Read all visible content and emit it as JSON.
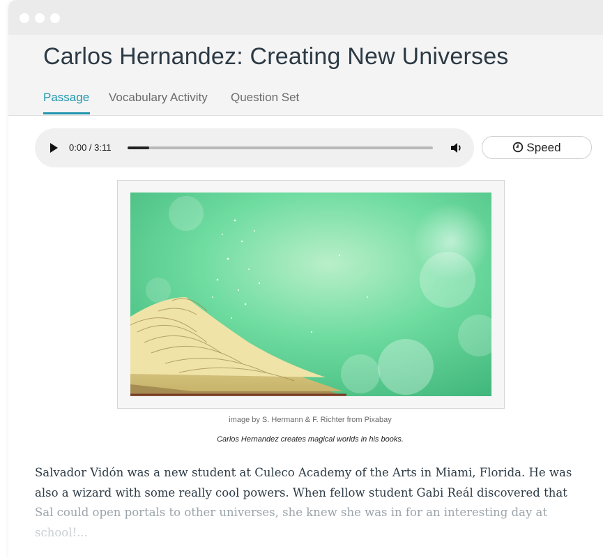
{
  "page": {
    "title": "Carlos Hernandez: Creating New Universes"
  },
  "tabs": [
    {
      "label": "Passage",
      "active": true
    },
    {
      "label": "Vocabulary Activity",
      "active": false
    },
    {
      "label": "Question Set",
      "active": false
    }
  ],
  "audio": {
    "time": "0:00 / 3:11",
    "progress": 0.07,
    "play_icon": "play-icon",
    "volume_icon": "volume-icon"
  },
  "speed_button": {
    "label": "Speed",
    "icon": "clock-icon"
  },
  "figure": {
    "credit": "image by S. Hermann & F. Richter from Pixabay",
    "caption": "Carlos Hernandez creates magical worlds in his books."
  },
  "passage": {
    "lines": [
      "Salvador Vidón was a new student at Culeco Academy of the Arts in Miami, Florida. He was",
      "also a wizard with some really cool powers. When fellow student Gabi Reál discovered that",
      "Sal could open portals to other universes, she knew she was in for an interesting day at",
      "school!..."
    ]
  },
  "colors": {
    "accent": "#1f95ad",
    "title": "#2c3a45",
    "header_bg": "#f4f4f4"
  }
}
